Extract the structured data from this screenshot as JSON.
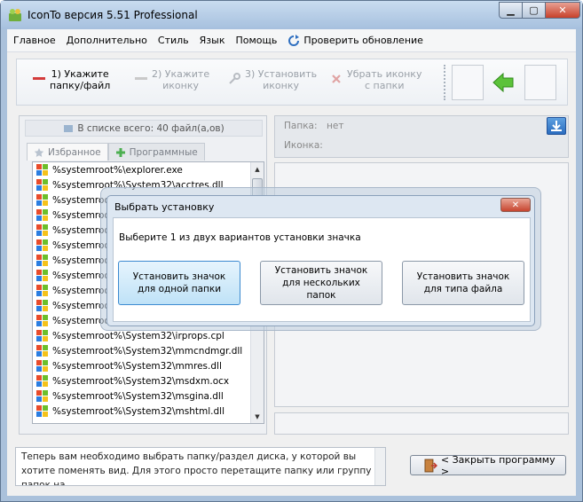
{
  "window": {
    "title": "IconTo версия 5.51 Professional"
  },
  "menu": [
    "Главное",
    "Дополнительно",
    "Стиль",
    "Язык",
    "Помощь"
  ],
  "menu_update": "Проверить обновление",
  "steps": [
    {
      "line1": "1)  Укажите",
      "line2": "папку/файл"
    },
    {
      "line1": "2)  Укажите",
      "line2": "иконку"
    },
    {
      "line1": "3)  Установить",
      "line2": "иконку"
    },
    {
      "line1": "Убрать иконку",
      "line2": "с папки"
    }
  ],
  "list_count": "В списке всего: 40 файл(а,ов)",
  "tabs": [
    "Избранное",
    "Программные"
  ],
  "files": [
    "%systemroot%\\explorer.exe",
    "%systemroot%\\System32\\acctres.dll",
    "%systemroot%\\System32\\appwiz.cpl.dll",
    "%systemroot%\\System32\\cedmgr.dll",
    "%systemroot%\\System32\\dsuiext.dll",
    "%systemroot%\\System32\\dxtmsft.dll",
    "%systemroot%\\System32\\filemgmt.dll",
    "%systemroot%\\System32\\gpedit.dll",
    "%systemroot%\\System32\\icardres.dll",
    "%systemroot%\\System32\\inetcpl.cpl",
    "%systemroot%\\System32\\ipsmsnap.dll",
    "%systemroot%\\System32\\irprops.cpl",
    "%systemroot%\\System32\\mmcndmgr.dll",
    "%systemroot%\\System32\\mmres.dll",
    "%systemroot%\\System32\\msdxm.ocx",
    "%systemroot%\\System32\\msgina.dll",
    "%systemroot%\\System32\\mshtml.dll"
  ],
  "right": {
    "folder_label": "Папка:",
    "folder_value": "нет",
    "icon_label": "Иконка:"
  },
  "status_text": "Теперь вам необходимо выбрать папку/раздел диска, у которой вы хотите поменять вид. Для этого просто перетащите папку или группу папок на",
  "close_button": "< Закрыть программу >",
  "dialog": {
    "title": "Выбрать установку",
    "message": "Выберите 1 из двух вариантов установки значка",
    "buttons": [
      "Установить значок для одной папки",
      "Установить значок для нескольких папок",
      "Установить значок для типа файла"
    ]
  }
}
